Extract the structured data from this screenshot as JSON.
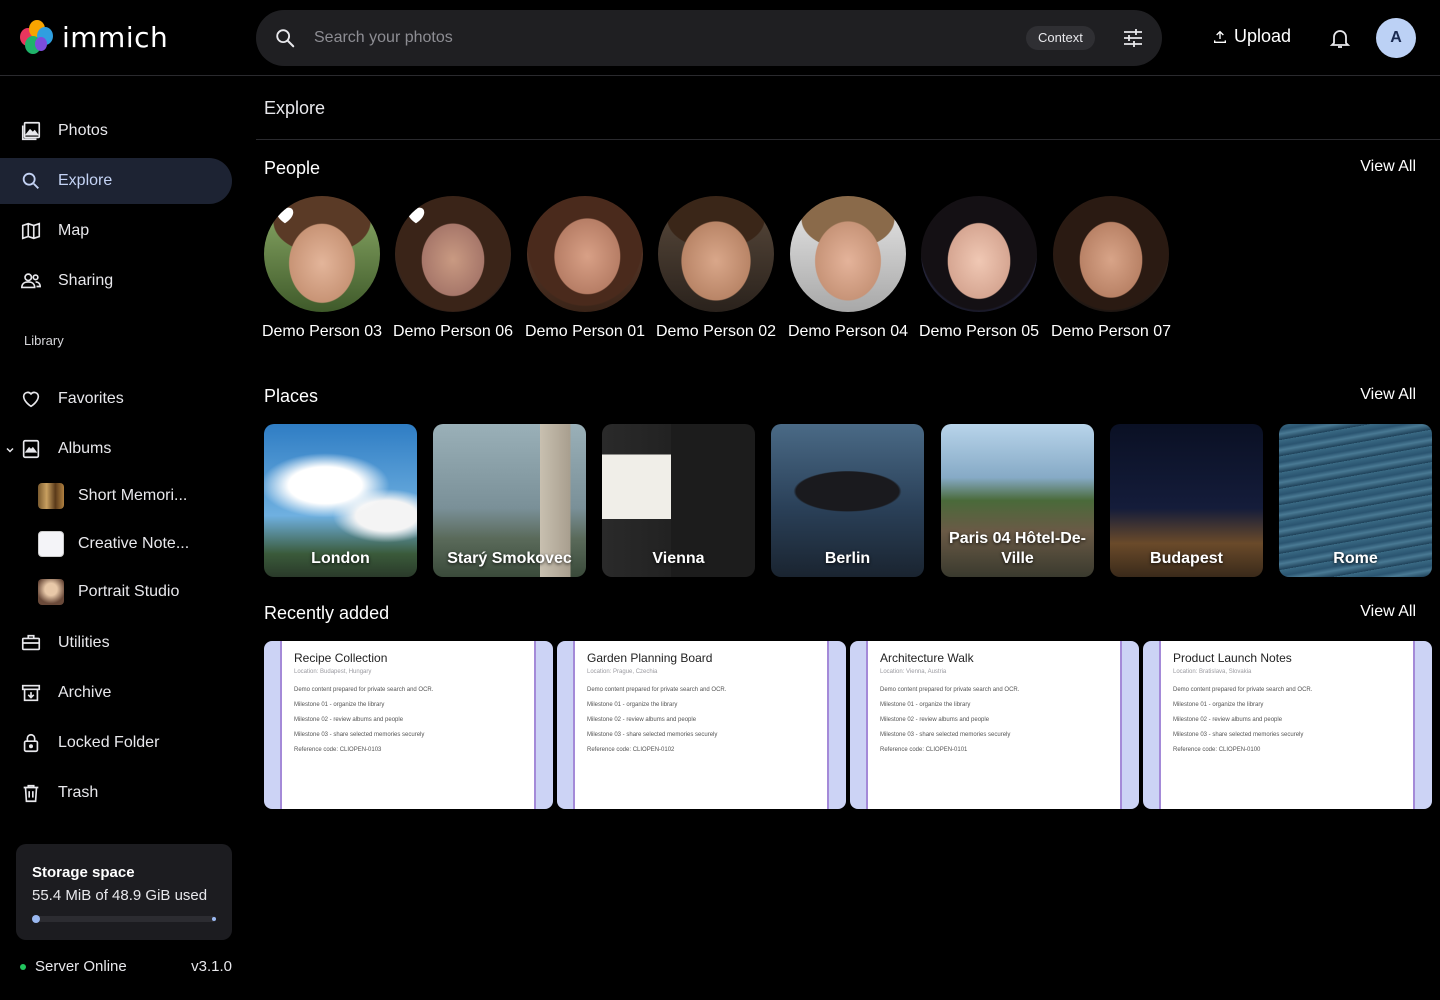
{
  "app": {
    "name": "immich"
  },
  "search": {
    "placeholder": "Search your photos",
    "context_label": "Context"
  },
  "header": {
    "upload_label": "Upload",
    "avatar_initial": "A"
  },
  "sidebar": {
    "items": [
      {
        "label": "Photos",
        "icon": "photos-icon"
      },
      {
        "label": "Explore",
        "icon": "search-icon",
        "active": true
      },
      {
        "label": "Map",
        "icon": "map-icon"
      },
      {
        "label": "Sharing",
        "icon": "people-icon"
      }
    ],
    "library_label": "Library",
    "library": [
      {
        "label": "Favorites",
        "icon": "heart-icon"
      },
      {
        "label": "Albums",
        "icon": "albums-icon"
      }
    ],
    "albums": [
      {
        "label": "Short Memori..."
      },
      {
        "label": "Creative Note..."
      },
      {
        "label": "Portrait Studio"
      }
    ],
    "more": [
      {
        "label": "Utilities",
        "icon": "toolbox-icon"
      },
      {
        "label": "Archive",
        "icon": "archive-icon"
      },
      {
        "label": "Locked Folder",
        "icon": "lock-icon"
      },
      {
        "label": "Trash",
        "icon": "trash-icon"
      }
    ],
    "storage": {
      "title": "Storage space",
      "text": "55.4 MiB of 48.9 GiB used",
      "fraction": 0.0011
    },
    "server": {
      "status": "Server Online",
      "version": "v3.1.0"
    }
  },
  "main": {
    "title": "Explore",
    "people_title": "People",
    "places_title": "Places",
    "recent_title": "Recently added",
    "view_all": "View All",
    "people": [
      {
        "name": "Demo Person 03",
        "favorite": true
      },
      {
        "name": "Demo Person 06",
        "favorite": true
      },
      {
        "name": "Demo Person 01",
        "favorite": false
      },
      {
        "name": "Demo Person 02",
        "favorite": false
      },
      {
        "name": "Demo Person 04",
        "favorite": false
      },
      {
        "name": "Demo Person 05",
        "favorite": false
      },
      {
        "name": "Demo Person 07",
        "favorite": false
      }
    ],
    "places": [
      {
        "name": "London"
      },
      {
        "name": "Starý Smokovec"
      },
      {
        "name": "Vienna"
      },
      {
        "name": "Berlin"
      },
      {
        "name": "Paris 04 Hôtel-De-Ville"
      },
      {
        "name": "Budapest"
      },
      {
        "name": "Rome"
      }
    ],
    "recent": [
      {
        "title": "Recipe Collection",
        "location": "Location: Budapest, Hungary",
        "code": "Reference code: CLIOPEN-0103"
      },
      {
        "title": "Garden Planning Board",
        "location": "Location: Prague, Czechia",
        "code": "Reference code: CLIOPEN-0102"
      },
      {
        "title": "Architecture Walk",
        "location": "Location: Vienna, Austria",
        "code": "Reference code: CLIOPEN-0101"
      },
      {
        "title": "Product Launch Notes",
        "location": "Location: Bratislava, Slovakia",
        "code": "Reference code: CLIOPEN-0100"
      }
    ],
    "card_lines": [
      "Demo content prepared for private search and OCR.",
      "Milestone 01 - organize the library",
      "Milestone 02 - review albums and people",
      "Milestone 03 - share selected memories securely"
    ]
  }
}
